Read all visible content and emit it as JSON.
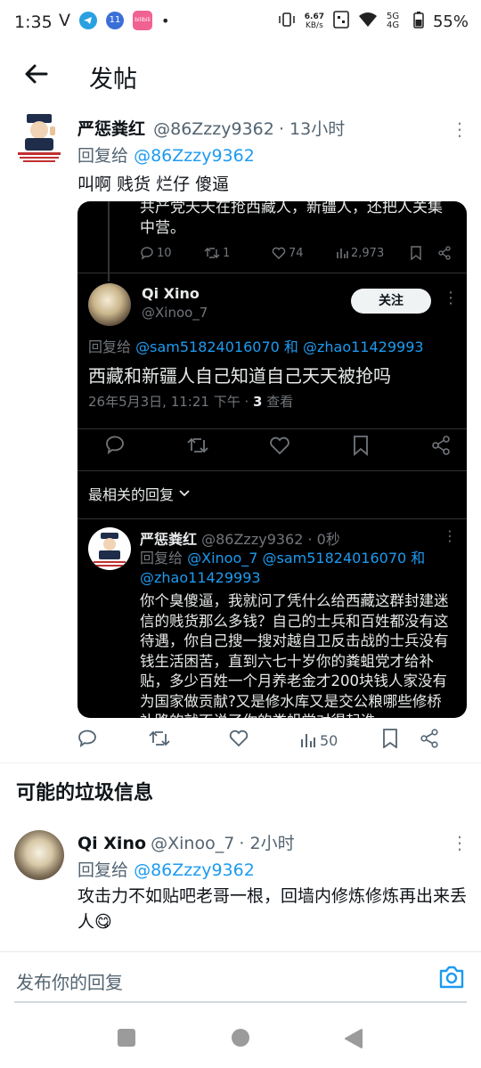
{
  "status_bar": {
    "time": "1:35",
    "carrier_letter": "V",
    "notif_count": "11",
    "app_badge": "bilibili",
    "dot": "•",
    "net_speed_value": "6.67",
    "net_speed_unit": "KB/s",
    "network": "5G 4G",
    "battery": "55%"
  },
  "header": {
    "title": "发帖"
  },
  "main_reply": {
    "name": "严惩粪红",
    "handle": "@86Zzzy9362",
    "time": "· 13小时",
    "reply_to_prefix": "回复给",
    "reply_to_handle": "@86Zzzy9362",
    "text": "叫啊 贱货 烂仔 傻逼",
    "more": "⋮",
    "actions": {
      "reply_count": "",
      "retweet_count": "",
      "like_count": "",
      "views": "50"
    }
  },
  "embed": {
    "top_text": "共产党天天在抢西藏人，新疆人，还把人关集中营。",
    "top_actions": {
      "replies": "10",
      "retweets": "1",
      "likes": "74",
      "views": "2,973"
    },
    "tweet": {
      "name": "Qi Xino",
      "handle": "@Xinoo_7",
      "follow_label": "关注",
      "more": "⋮",
      "reply_to_prefix": "回复给",
      "reply_to_users": "@sam51824016070 和 @zhao11429993",
      "text": "西藏和新疆人自己知道自己天天被抢吗",
      "timestamp": "26年5月3日, 11:21 下午 · ",
      "views_count": "3",
      "views_label": " 查看"
    },
    "sort_label": "最相关的回复",
    "nested_reply": {
      "name": "严惩粪红",
      "handle": "@86Zzzy9362 · 0秒",
      "more": "⋮",
      "reply_to_prefix": "回复给",
      "reply_to_line1": "@Xinoo_7 @sam51824016070 和",
      "reply_to_line2": "@zhao11429993",
      "text": "你个臭傻逼，我就问了凭什么给西藏这群封建迷信的贱货那么多钱？自己的士兵和百姓都没有这待遇，你自己搜一搜对越自卫反击战的士兵没有钱生活困苦，直到六七十岁你的粪蛆党才给补贴，多少百姓一个月养老金才200块钱人家没有为国家做贡献?又是修水库又是交公粮哪些修桥补路的就不说了你的粪蛆党对得起谁"
    }
  },
  "spam_section": {
    "title": "可能的垃圾信息",
    "reply": {
      "name": "Qi Xino",
      "handle": "@Xinoo_7",
      "time": "· 2小时",
      "more": "⋮",
      "reply_to_prefix": "回复给",
      "reply_to_handle": "@86Zzzy9362",
      "text": "攻击力不如贴吧老哥一根，回墙内修炼修炼再出来丢人😋"
    }
  },
  "reply_bar": {
    "placeholder": "发布你的回复"
  },
  "colors": {
    "accent": "#1d9bf0",
    "text": "#0f1419",
    "secondary": "#536471",
    "embed_bg": "#000000"
  }
}
